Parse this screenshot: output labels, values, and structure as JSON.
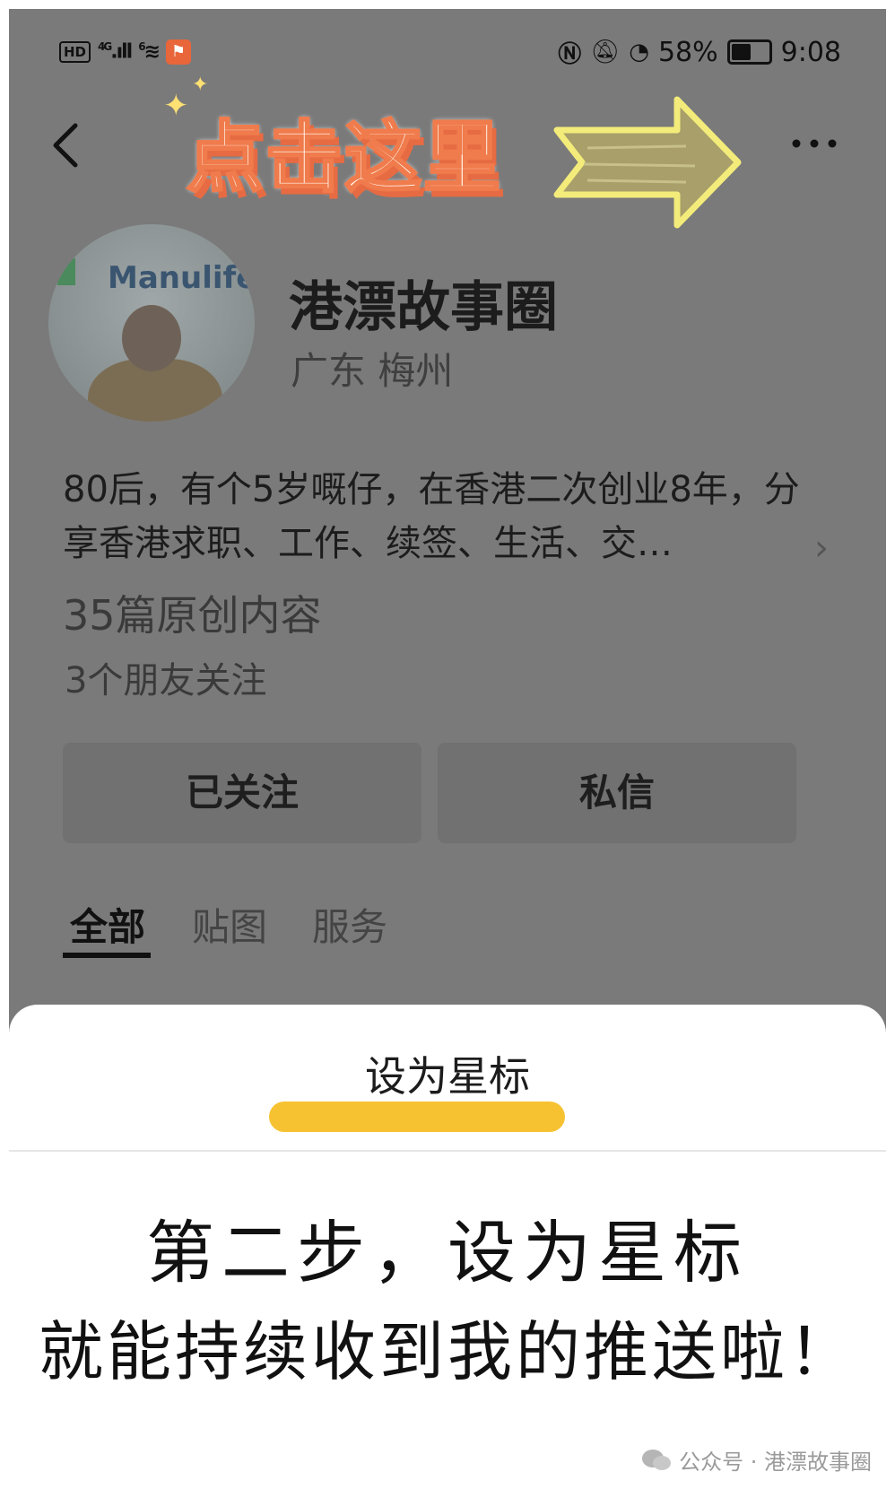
{
  "status_bar": {
    "hd": "HD",
    "network_4g": "4G",
    "network_6": "6",
    "battery": "58%",
    "battery_level": 0.58,
    "time": "9:08"
  },
  "annotation": {
    "click_here": "点击这里"
  },
  "profile": {
    "avatar_logo": "Manulife",
    "name": "港漂故事圈",
    "location": "广东 梅州",
    "bio": "80后，有个5岁嘅仔，在香港二次创业8年，分享香港求职、工作、续签、生活、交…",
    "original_count": "35篇原创内容",
    "friends_following": "3个朋友关注"
  },
  "actions": {
    "follow": "已关注",
    "message": "私信"
  },
  "tabs": [
    "全部",
    "贴图",
    "服务"
  ],
  "sheet": {
    "title": "设为星标"
  },
  "caption": {
    "step": "第二步，设为星标",
    "push": "就能持续收到我的推送啦！"
  },
  "watermark": "公众号 · 港漂故事圈",
  "colors": {
    "overlay": "#7a7a7a",
    "highlight": "#f7c232",
    "annotation_orange": "#f07b4c",
    "arrow_yellow": "#f3ec7a"
  }
}
